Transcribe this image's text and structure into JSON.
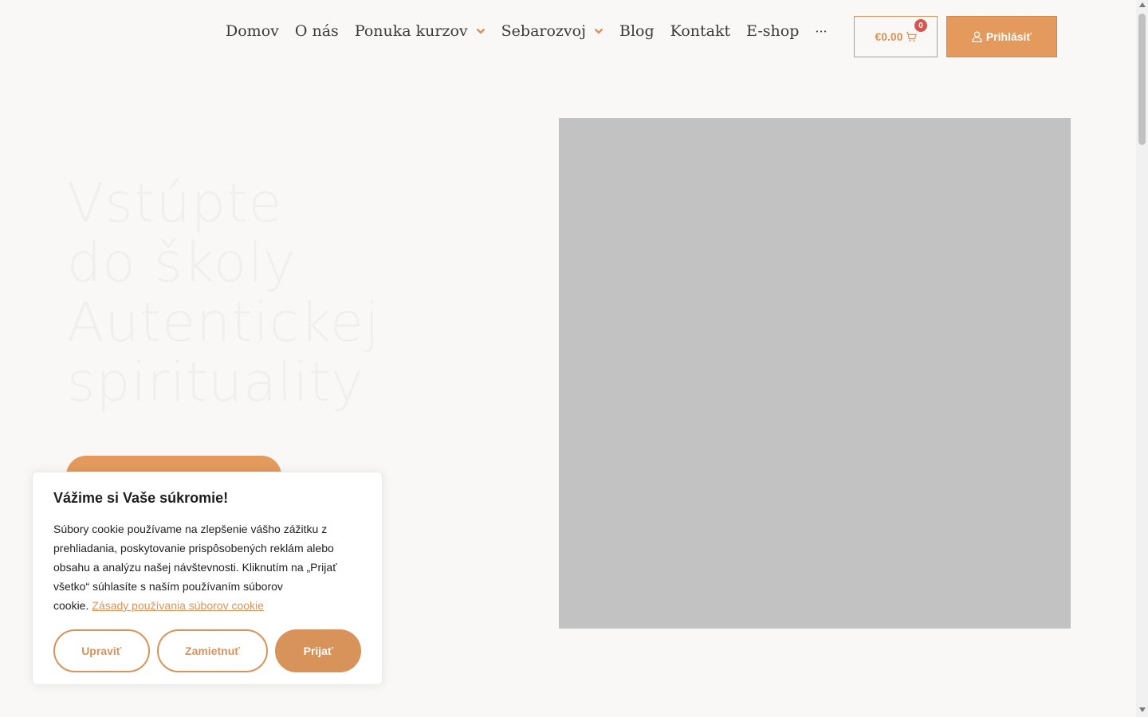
{
  "nav": {
    "items": [
      {
        "label": "Domov",
        "has_dropdown": false
      },
      {
        "label": "O nás",
        "has_dropdown": false
      },
      {
        "label": "Ponuka kurzov",
        "has_dropdown": true
      },
      {
        "label": "Sebarozvoj",
        "has_dropdown": true
      },
      {
        "label": "Blog",
        "has_dropdown": false
      },
      {
        "label": "Kontakt",
        "has_dropdown": false
      },
      {
        "label": "E-shop",
        "has_dropdown": false
      }
    ],
    "more_label": "···"
  },
  "cart": {
    "total": "€0.00",
    "count": "0",
    "icon": "cart-icon"
  },
  "login": {
    "label": "Prihlásiť",
    "icon": "user-icon"
  },
  "hero": {
    "title_lines": [
      "Vstúpte",
      "do školy",
      "Autentickej",
      "spirituality"
    ]
  },
  "cookie": {
    "title": "Vážime si Vaše súkromie!",
    "text": "Súbory cookie používame na zlepšenie vášho zážitku z prehliadania, poskytovanie prispôsobených reklám alebo obsahu a analýzu našej návštevnosti. Kliknutím na „Prijať všetko“ súhlasíte s naším používaním súborov cookie.",
    "policy_link": "Zásady používania súborov cookie",
    "customize_label": "Upraviť",
    "reject_label": "Zamietnuť",
    "accept_label": "Prijať"
  },
  "colors": {
    "accent": "#e39a5c",
    "accent_dark": "#d8935a",
    "background": "#f9f8f6",
    "placeholder": "#c2c2c2",
    "badge": "#d9534f"
  }
}
